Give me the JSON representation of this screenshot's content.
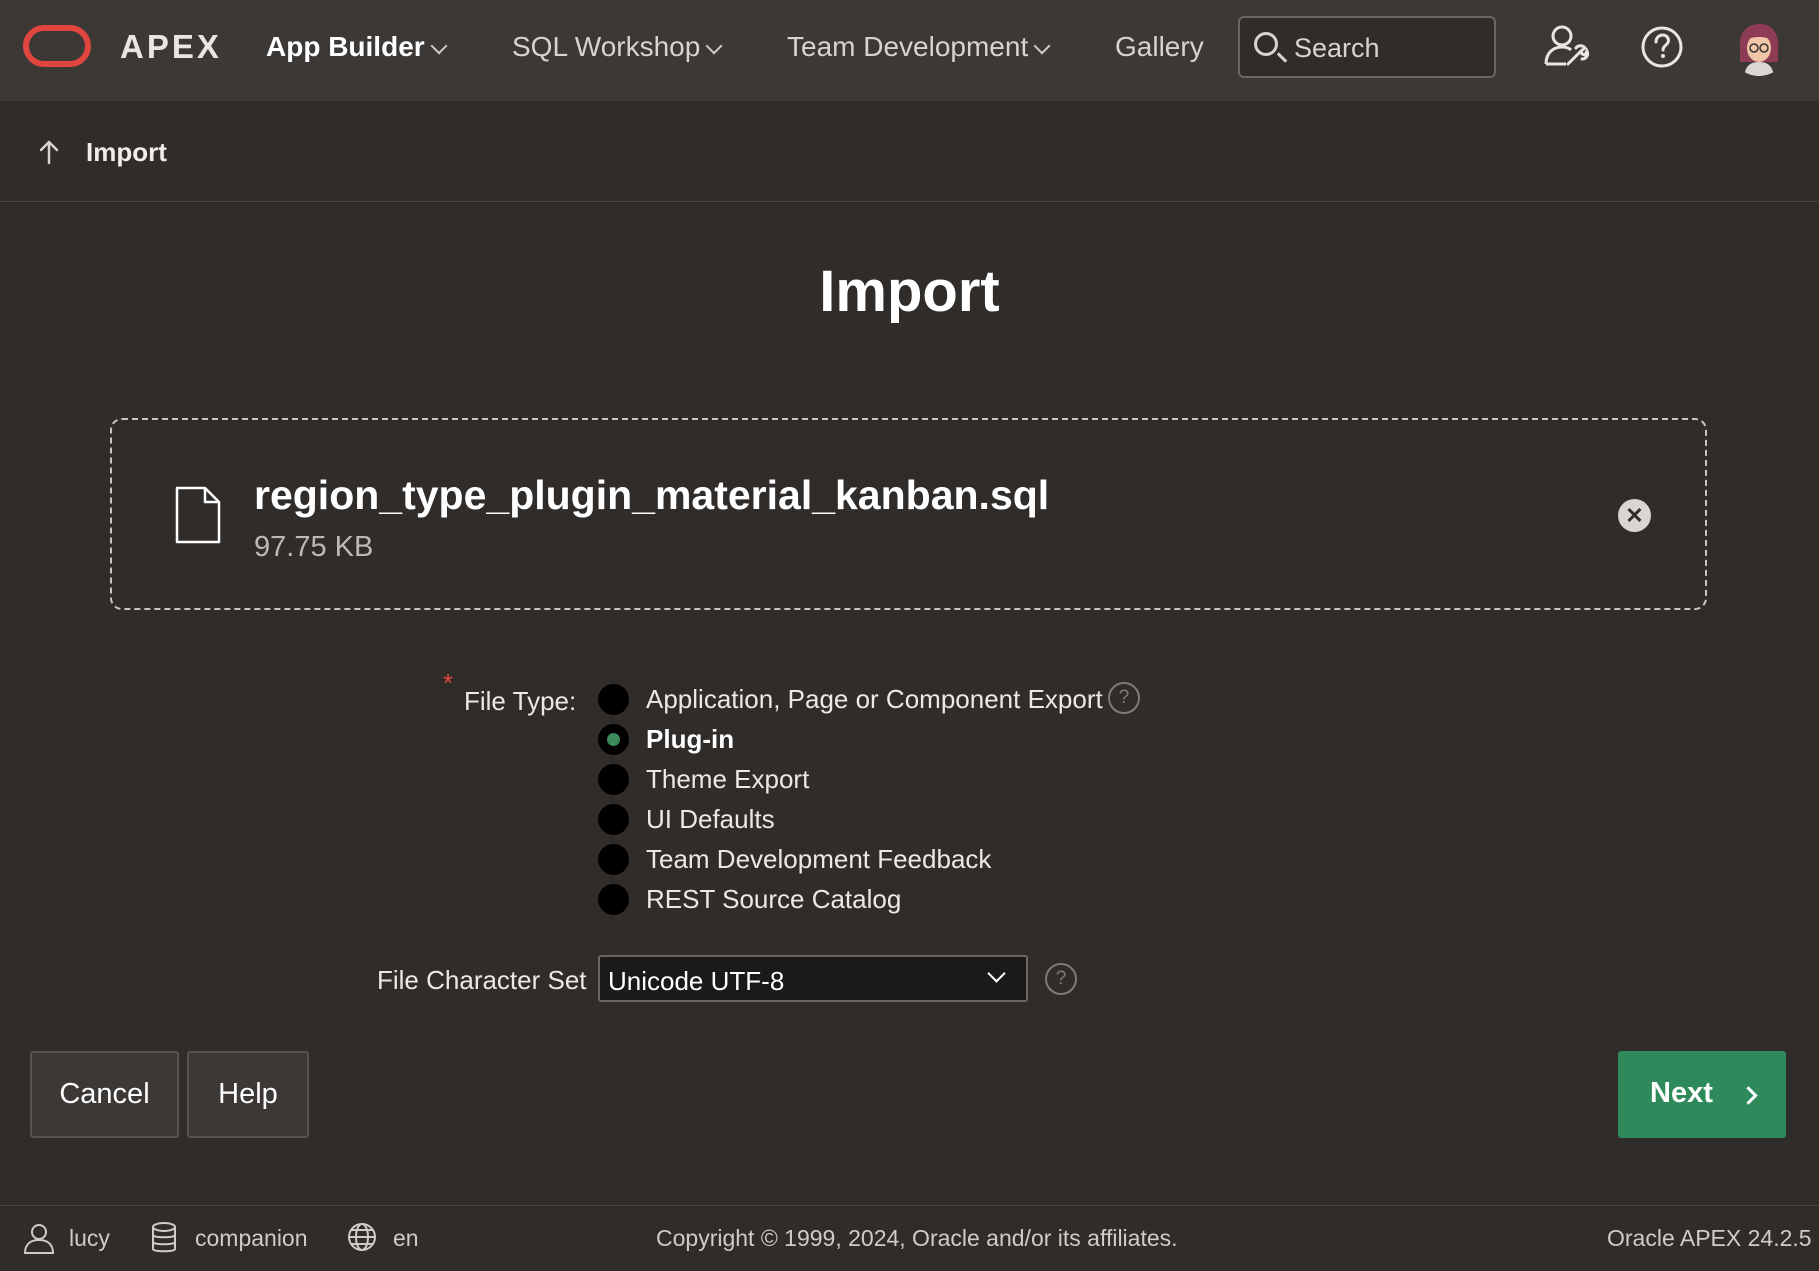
{
  "brand": {
    "name": "APEX"
  },
  "nav": {
    "items": [
      {
        "label": "App Builder",
        "active": true,
        "has_menu": true
      },
      {
        "label": "SQL Workshop",
        "active": false,
        "has_menu": true
      },
      {
        "label": "Team Development",
        "active": false,
        "has_menu": true
      },
      {
        "label": "Gallery",
        "active": false,
        "has_menu": false
      }
    ],
    "search_placeholder": "Search"
  },
  "breadcrumb": {
    "label": "Import"
  },
  "page": {
    "title": "Import"
  },
  "upload": {
    "file_name": "region_type_plugin_material_kanban.sql",
    "file_size": "97.75 KB"
  },
  "form": {
    "file_type_label": "File Type:",
    "file_type_options": [
      {
        "label": "Application, Page or Component Export",
        "checked": false
      },
      {
        "label": "Plug-in",
        "checked": true
      },
      {
        "label": "Theme Export",
        "checked": false
      },
      {
        "label": "UI Defaults",
        "checked": false
      },
      {
        "label": "Team Development Feedback",
        "checked": false
      },
      {
        "label": "REST Source Catalog",
        "checked": false
      }
    ],
    "charset_label": "File Character Set",
    "charset_value": "Unicode UTF-8"
  },
  "buttons": {
    "cancel": "Cancel",
    "help": "Help",
    "next": "Next"
  },
  "footer": {
    "user": "lucy",
    "workspace": "companion",
    "language": "en",
    "copyright": "Copyright © 1999, 2024, Oracle and/or its affiliates.",
    "version": "Oracle APEX 24.2.5"
  },
  "colors": {
    "accent_green": "#2f8a5b",
    "brand_red": "#e0463d",
    "background": "#2f2c2a",
    "header": "#3b3836"
  }
}
